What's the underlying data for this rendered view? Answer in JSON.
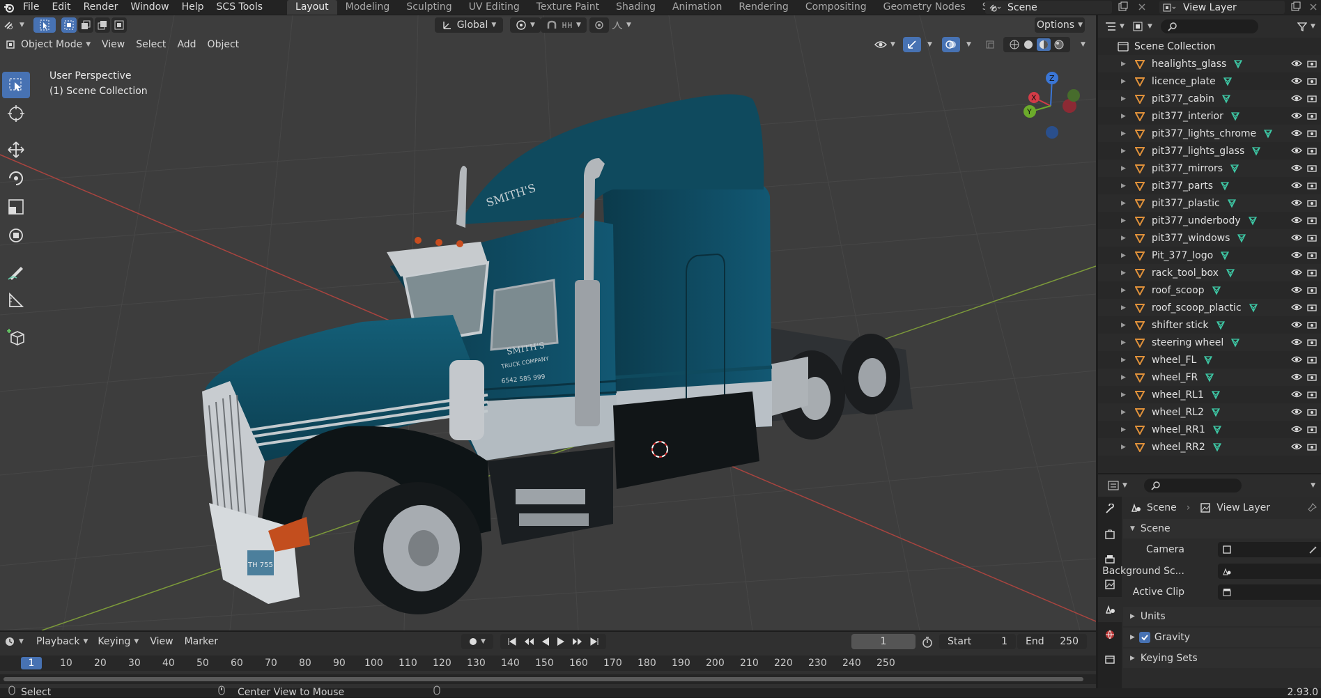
{
  "menubar": {
    "items": [
      "File",
      "Edit",
      "Render",
      "Window",
      "Help",
      "SCS Tools"
    ],
    "workspaces": [
      "Layout",
      "Modeling",
      "Sculpting",
      "UV Editing",
      "Texture Paint",
      "Shading",
      "Animation",
      "Rendering",
      "Compositing",
      "Geometry Nodes",
      "Scripting"
    ],
    "active_workspace": "Layout",
    "scene_name": "Scene",
    "view_layer_name": "View Layer"
  },
  "viewport": {
    "transform_orientation": "Global",
    "options_label": "Options",
    "mode": "Object Mode",
    "menus": [
      "View",
      "Select",
      "Add",
      "Object"
    ],
    "perspective_label": "User Perspective",
    "collection_label": "(1) Scene Collection",
    "gizmo_axes": [
      "X",
      "Y",
      "Z"
    ],
    "truck_logo_text": "SMITH'S",
    "truck_subtext": "TRUCK COMPANY",
    "truck_phone": "6542 585 999",
    "plate_text": "TH 755",
    "colors": {
      "background": "#3d3d3d",
      "grid": "#4a4a4a",
      "x_axis": "#a8443f",
      "y_axis": "#7c9a3a",
      "truck_blue": "#0f4a5e"
    }
  },
  "outliner": {
    "root": "Scene Collection",
    "items": [
      "healights_glass",
      "licence_plate",
      "pit377_cabin",
      "pit377_interior",
      "pit377_lights_chrome",
      "pit377_lights_glass",
      "pit377_mirrors",
      "pit377_parts",
      "pit377_plastic",
      "pit377_underbody",
      "pit377_windows",
      "Pit_377_logo",
      "rack_tool_box",
      "roof_scoop",
      "roof_scoop_plactic",
      "shifter stick",
      "steering wheel",
      "wheel_FL",
      "wheel_FR",
      "wheel_RL1",
      "wheel_RL2",
      "wheel_RR1",
      "wheel_RR2"
    ]
  },
  "properties": {
    "breadcrumb_scene": "Scene",
    "breadcrumb_view_layer": "View Layer",
    "panel_scene": "Scene",
    "camera_label": "Camera",
    "background_label": "Background Sc...",
    "active_clip_label": "Active Clip",
    "units_label": "Units",
    "gravity_label": "Gravity",
    "gravity_checked": true,
    "keying_sets_label": "Keying Sets"
  },
  "timeline": {
    "menus": [
      "Playback",
      "Keying",
      "View",
      "Marker"
    ],
    "current_frame": "1",
    "start_label": "Start",
    "start_value": "1",
    "end_label": "End",
    "end_value": "250",
    "ruler_current": "1",
    "ruler_ticks": [
      "10",
      "20",
      "30",
      "40",
      "50",
      "60",
      "70",
      "80",
      "90",
      "100",
      "110",
      "120",
      "130",
      "140",
      "150",
      "160",
      "170",
      "180",
      "190",
      "200",
      "210",
      "220",
      "230",
      "240",
      "250"
    ]
  },
  "statusbar": {
    "left": "Select",
    "middle": "Center View to Mouse",
    "version": "2.93.0"
  }
}
